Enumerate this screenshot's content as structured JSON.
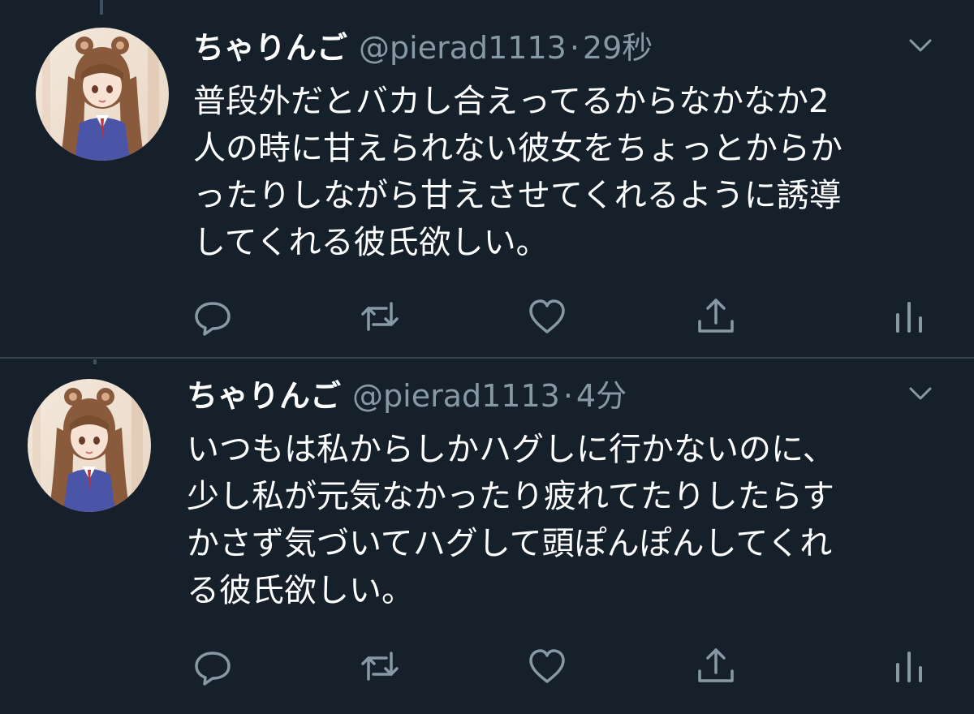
{
  "tweets": [
    {
      "display_name": "ちゃりんご",
      "handle": "@pierad1113",
      "separator": "·",
      "time": "29秒",
      "lines": [
        "普段外だとバカし合えってるからなかなか2",
        "人の時に甘えられない彼女をちょっとからか",
        "ったりしながら甘えさせてくれるように誘導",
        "してくれる彼氏欲しい。"
      ]
    },
    {
      "display_name": "ちゃりんご",
      "handle": "@pierad1113",
      "separator": "·",
      "time": "4分",
      "lines": [
        "いつもは私からしかハグしに行かないのに、",
        "少し私が元気なかったり疲れてたりしたらす",
        "かさず気づいてハグして頭ぽんぽんしてくれ",
        "る彼氏欲しい。"
      ]
    }
  ],
  "icons": {
    "reply": "reply-icon",
    "retweet": "retweet-icon",
    "like": "like-icon",
    "share": "share-icon",
    "analytics": "analytics-icon",
    "caret": "chevron-down-icon"
  },
  "colors": {
    "background": "#15202b",
    "text_primary": "#ffffff",
    "text_secondary": "#8899a6",
    "divider": "#38444d"
  }
}
